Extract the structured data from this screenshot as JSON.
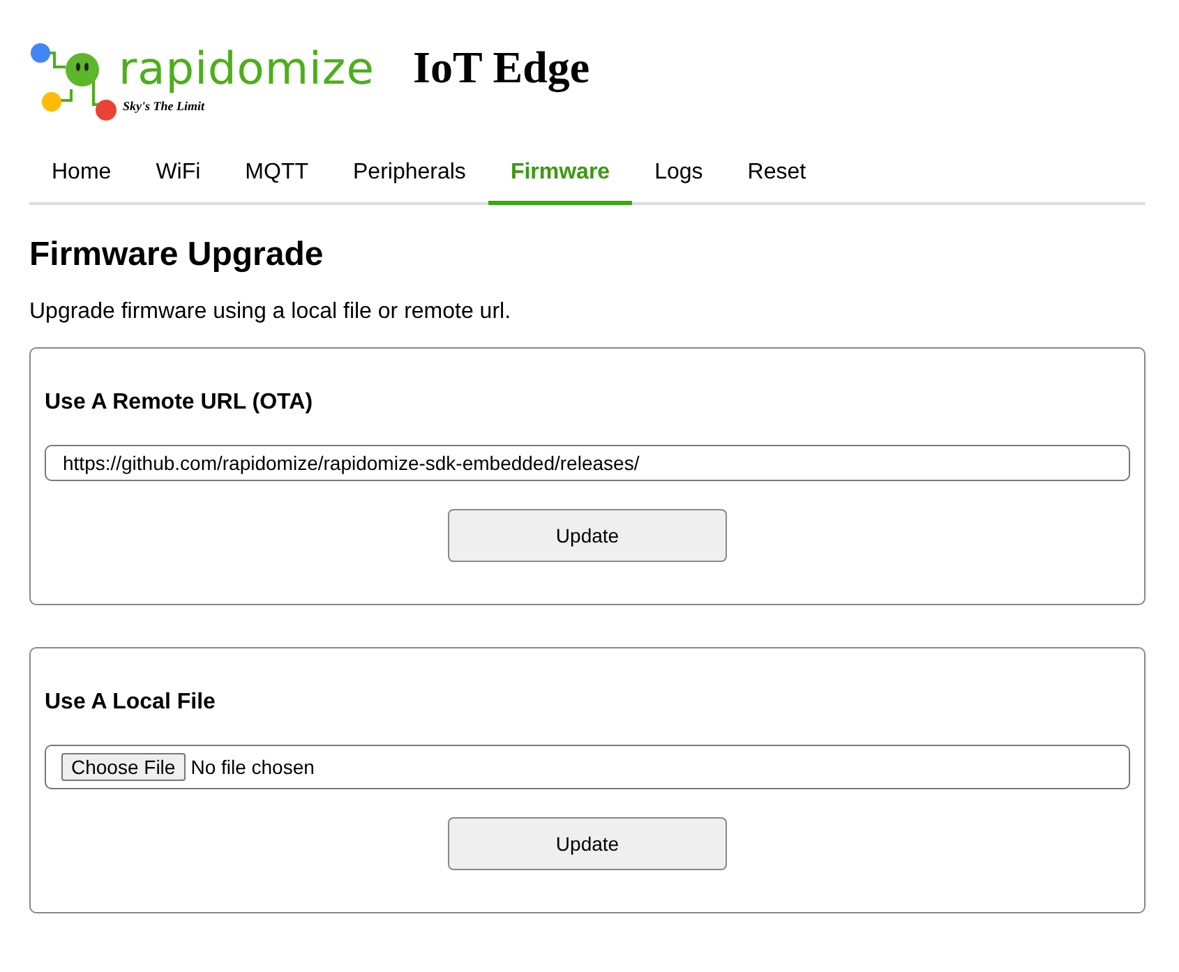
{
  "header": {
    "logo_text": "rapidomize",
    "logo_tagline": "Sky's The Limit",
    "title": "IoT Edge"
  },
  "tabs": [
    {
      "label": "Home",
      "selected": false
    },
    {
      "label": "WiFi",
      "selected": false
    },
    {
      "label": "MQTT",
      "selected": false
    },
    {
      "label": "Peripherals",
      "selected": false
    },
    {
      "label": "Firmware",
      "selected": true
    },
    {
      "label": "Logs",
      "selected": false
    },
    {
      "label": "Reset",
      "selected": false
    }
  ],
  "heading": "Firmware Upgrade",
  "intro": "Upgrade firmware using a local file or remote url.",
  "sections": [
    {
      "kind": "url",
      "title": "Use A Remote URL (OTA)",
      "value": "https://github.com/rapidomize/rapidomize-sdk-embedded/releases/",
      "button": "Update"
    },
    {
      "kind": "file",
      "title": "Use A Local File",
      "file_button": "Choose File",
      "file_status": "No file chosen",
      "button": "Update"
    }
  ]
}
